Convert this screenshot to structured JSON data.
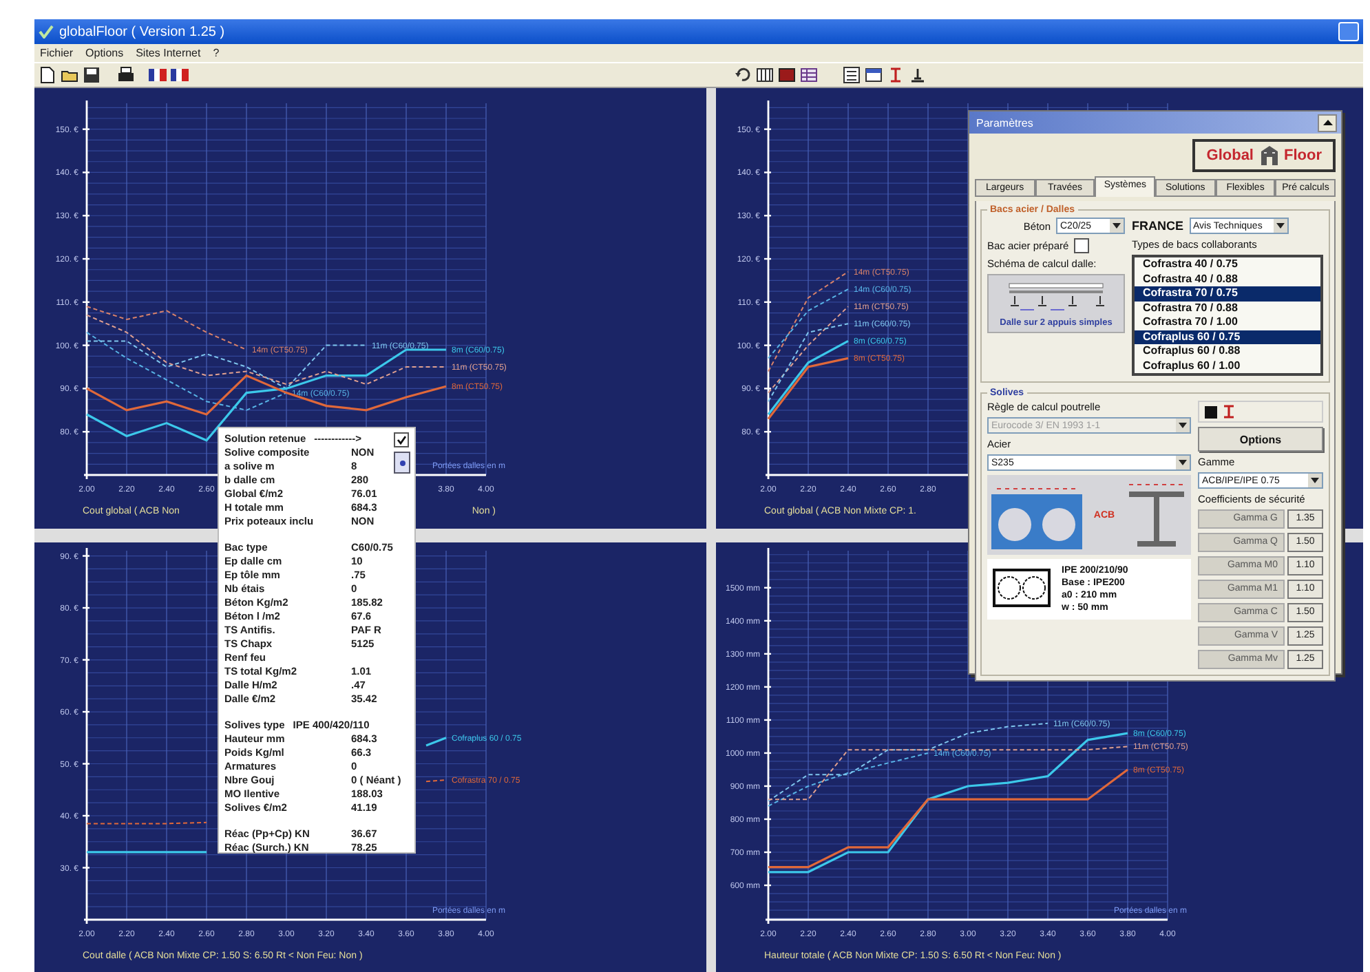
{
  "window": {
    "title": "globalFloor ( Version 1.25 )"
  },
  "menu": [
    "Fichier",
    "Options",
    "Sites Internet",
    "?"
  ],
  "charts": [
    {
      "footer": [
        "Cout global ( ACB Non",
        "Non )"
      ],
      "chart_data": {
        "type": "line",
        "grid": true,
        "x": [
          2,
          2.2,
          2.4,
          2.6,
          2.8,
          3,
          3.2,
          3.4,
          3.6,
          3.8
        ],
        "xlim": [
          2,
          4
        ],
        "ylim": [
          70,
          156
        ],
        "xlabel": "Portées dalles en m",
        "xticks": [
          {
            "value": 2,
            "label": "2.00"
          },
          {
            "value": 2.2,
            "label": "2.20"
          },
          {
            "value": 2.4,
            "label": "2.40"
          },
          {
            "value": 2.6,
            "label": "2.60"
          },
          {
            "value": 3.8,
            "label": "3.80"
          },
          {
            "value": 4,
            "label": "4.00"
          }
        ],
        "yticks": [
          {
            "value": 150,
            "label": "150. €"
          },
          {
            "value": 140,
            "label": "140. €"
          },
          {
            "value": 130,
            "label": "130. €"
          },
          {
            "value": 120,
            "label": "120. €"
          },
          {
            "value": 110,
            "label": "110. €"
          },
          {
            "value": 100,
            "label": "100. €"
          },
          {
            "value": 90,
            "label": "90. €"
          },
          {
            "value": 80,
            "label": "80. €"
          }
        ],
        "series": [
          {
            "name": "14m (CT50.75)",
            "color": "#d9826a",
            "line_style": "dashed",
            "values": [
              109,
              106,
              108,
              103,
              99,
              null,
              null,
              null,
              null,
              null
            ]
          },
          {
            "name": "14m (C60/0.75)",
            "color": "#58b4e6",
            "line_style": "dashed",
            "values": [
              103,
              97,
              92,
              87,
              85,
              89,
              null,
              null,
              null,
              null
            ]
          },
          {
            "name": "11m (C60/0.75)",
            "color": "#7fc6ee",
            "line_style": "dashed",
            "values": [
              101,
              101,
              95,
              98,
              95,
              90,
              100,
              100,
              null,
              null
            ]
          },
          {
            "name": "8m (C60/0.75)",
            "color": "#3cc8ea",
            "line_style": "solid",
            "values": [
              84,
              79,
              82,
              78,
              89,
              90,
              93,
              93,
              99,
              99
            ]
          },
          {
            "name": "11m (CT50.75)",
            "color": "#e0a090",
            "line_style": "dashed",
            "values": [
              107,
              103,
              96,
              93,
              94,
              91,
              94,
              91,
              95,
              95
            ]
          },
          {
            "name": "8m (CT50.75)",
            "color": "#e0683a",
            "line_style": "solid",
            "values": [
              90,
              85,
              87,
              84,
              93,
              89,
              86,
              85,
              88,
              90.5
            ]
          }
        ]
      }
    },
    {
      "footer": [
        "Cout global ( ACB Non Mixte CP: 1."
      ],
      "chart_data": {
        "type": "line",
        "grid": true,
        "x": [
          2,
          2.2,
          2.4
        ],
        "xlim": [
          2,
          4
        ],
        "ylim": [
          70,
          156
        ],
        "xticks": [
          {
            "value": 2,
            "label": "2.00"
          },
          {
            "value": 2.2,
            "label": "2.20"
          },
          {
            "value": 2.4,
            "label": "2.40"
          },
          {
            "value": 2.6,
            "label": "2.60"
          },
          {
            "value": 2.8,
            "label": "2.80"
          }
        ],
        "yticks": [
          {
            "value": 150,
            "label": "150. €"
          },
          {
            "value": 140,
            "label": "140. €"
          },
          {
            "value": 130,
            "label": "130. €"
          },
          {
            "value": 120,
            "label": "120. €"
          },
          {
            "value": 110,
            "label": "110. €"
          },
          {
            "value": 100,
            "label": "100. €"
          },
          {
            "value": 90,
            "label": "90. €"
          },
          {
            "value": 80,
            "label": "80. €"
          }
        ],
        "series": [
          {
            "name": "14m (CT50.75)",
            "color": "#d9826a",
            "line_style": "dashed",
            "values": [
              94,
              111,
              117
            ]
          },
          {
            "name": "14m (C60/0.75)",
            "color": "#58b4e6",
            "line_style": "dashed",
            "values": [
              97,
              108,
              113
            ]
          },
          {
            "name": "11m (CT50.75)",
            "color": "#e0a090",
            "line_style": "dashed",
            "values": [
              89,
              100,
              109
            ]
          },
          {
            "name": "11m (C60/0.75)",
            "color": "#7fc6ee",
            "line_style": "dashed",
            "values": [
              87,
              103,
              105
            ]
          },
          {
            "name": "8m (C60/0.75)",
            "color": "#3cc8ea",
            "line_style": "solid",
            "values": [
              84,
              96,
              101
            ]
          },
          {
            "name": "8m (CT50.75)",
            "color": "#e0683a",
            "line_style": "solid",
            "values": [
              83,
              95,
              97
            ]
          }
        ]
      }
    },
    {
      "footer": [
        "Cout dalle ( ACB Non Mixte CP: 1.50 S: 6.50 Rt < Non Feu: Non )"
      ],
      "chart_data": {
        "type": "line",
        "grid": true,
        "x": [
          2,
          2.2,
          2.4,
          2.6,
          3.7,
          3.8
        ],
        "xlim": [
          2,
          4
        ],
        "ylim": [
          20,
          91
        ],
        "xlabel": "Portées dalles en m",
        "xticks": [
          {
            "value": 2,
            "label": "2.00"
          },
          {
            "value": 2.2,
            "label": "2.20"
          },
          {
            "value": 2.4,
            "label": "2.40"
          },
          {
            "value": 2.6,
            "label": "2.60"
          },
          {
            "value": 2.8,
            "label": "2.80"
          },
          {
            "value": 3,
            "label": "3.00"
          },
          {
            "value": 3.2,
            "label": "3.20"
          },
          {
            "value": 3.4,
            "label": "3.40"
          },
          {
            "value": 3.6,
            "label": "3.60"
          },
          {
            "value": 3.8,
            "label": "3.80"
          },
          {
            "value": 4,
            "label": "4.00"
          }
        ],
        "yticks": [
          {
            "value": 90,
            "label": "90. €"
          },
          {
            "value": 80,
            "label": "80. €"
          },
          {
            "value": 70,
            "label": "70. €"
          },
          {
            "value": 60,
            "label": "60. €"
          },
          {
            "value": 50,
            "label": "50. €"
          },
          {
            "value": 40,
            "label": "40. €"
          },
          {
            "value": 30,
            "label": "30. €"
          }
        ],
        "series": [
          {
            "name": "Cofraplus 60 / 0.75",
            "color": "#3cc8ea",
            "line_style": "solid",
            "values": [
              33,
              33,
              33,
              33,
              53.5,
              55
            ]
          },
          {
            "name": "Cofrastra 70 / 0.75",
            "color": "#e0683a",
            "line_style": "dashed",
            "values": [
              38.5,
              38.5,
              38.5,
              38.7,
              46.6,
              46.9
            ]
          }
        ]
      }
    },
    {
      "footer": [
        "Hauteur totale ( ACB Non Mixte CP: 1.50 S: 6.50 Rt < Non Feu: Non )"
      ],
      "chart_data": {
        "type": "line",
        "grid": true,
        "x": [
          2,
          2.2,
          2.4,
          2.6,
          2.8,
          3,
          3.2,
          3.4,
          3.6,
          3.8
        ],
        "xlim": [
          2,
          4
        ],
        "ylim": [
          496,
          1612
        ],
        "xlabel": "Portées dalles en m",
        "xticks": [
          {
            "value": 2,
            "label": "2.00"
          },
          {
            "value": 2.2,
            "label": "2.20"
          },
          {
            "value": 2.4,
            "label": "2.40"
          },
          {
            "value": 2.6,
            "label": "2.60"
          },
          {
            "value": 2.8,
            "label": "2.80"
          },
          {
            "value": 3,
            "label": "3.00"
          },
          {
            "value": 3.2,
            "label": "3.20"
          },
          {
            "value": 3.4,
            "label": "3.40"
          },
          {
            "value": 3.6,
            "label": "3.60"
          },
          {
            "value": 3.8,
            "label": "3.80"
          },
          {
            "value": 4,
            "label": "4.00"
          }
        ],
        "yticks": [
          {
            "value": 1500,
            "label": "1500 mm"
          },
          {
            "value": 1400,
            "label": "1400 mm"
          },
          {
            "value": 1300,
            "label": "1300 mm"
          },
          {
            "value": 1200,
            "label": "1200 mm"
          },
          {
            "value": 1100,
            "label": "1100 mm"
          },
          {
            "value": 1000,
            "label": "1000 mm"
          },
          {
            "value": 900,
            "label": "900 mm"
          },
          {
            "value": 800,
            "label": "800 mm"
          },
          {
            "value": 700,
            "label": "700 mm"
          },
          {
            "value": 600,
            "label": "600 mm"
          }
        ],
        "series": [
          {
            "name": "14m (C60/0.75)",
            "color": "#58b4e6",
            "line_style": "dashed",
            "values": [
              840,
              900,
              940,
              970,
              1000,
              null,
              null,
              null,
              null,
              null
            ]
          },
          {
            "name": "11m (C60/0.75)",
            "color": "#7fc6ee",
            "line_style": "dashed",
            "values": [
              855,
              935,
              935,
              1010,
              1010,
              1060,
              1080,
              1090,
              null,
              null
            ]
          },
          {
            "name": "8m (C60/0.75)",
            "color": "#3cc8ea",
            "line_style": "solid",
            "values": [
              640,
              640,
              700,
              700,
              860,
              900,
              910,
              930,
              1040,
              1060
            ]
          },
          {
            "name": "11m (CT50.75)",
            "color": "#e0a090",
            "line_style": "dashed",
            "values": [
              860,
              860,
              1010,
              1010,
              1010,
              1010,
              1010,
              1010,
              1010,
              1020
            ]
          },
          {
            "name": "8m (CT50.75)",
            "color": "#e0683a",
            "line_style": "solid",
            "values": [
              655,
              655,
              715,
              715,
              860,
              860,
              860,
              860,
              860,
              950
            ]
          }
        ]
      }
    }
  ],
  "solution_popup": {
    "checked": true,
    "sections": [
      [
        {
          "kind": "inline",
          "label": "Solution retenue",
          "value": "------------>"
        },
        {
          "kind": "pair",
          "label": "Solive composite",
          "value": "NON"
        },
        {
          "kind": "pair",
          "label": "a solive m",
          "value": "8"
        },
        {
          "kind": "pair",
          "label": "b dalle cm",
          "value": "280"
        },
        {
          "kind": "pair",
          "label": "Global €/m2",
          "value": "76.01"
        },
        {
          "kind": "pair",
          "label": "H totale mm",
          "value": "684.3"
        },
        {
          "kind": "pair",
          "label": "Prix poteaux inclu",
          "value": "NON"
        }
      ],
      [
        {
          "kind": "pair",
          "label": "Bac type",
          "value": "C60/0.75"
        },
        {
          "kind": "pair",
          "label": "Ep dalle cm",
          "value": "10"
        },
        {
          "kind": "pair",
          "label": "Ep tôle mm",
          "value": ".75"
        },
        {
          "kind": "pair",
          "label": "Nb étais",
          "value": "0"
        },
        {
          "kind": "pair",
          "label": "Béton Kg/m2",
          "value": "185.82"
        },
        {
          "kind": "pair",
          "label": "Béton l /m2",
          "value": "67.6"
        },
        {
          "kind": "pair",
          "label": "TS Antifis.",
          "value": "PAF R"
        },
        {
          "kind": "pair",
          "label": "TS Chapx",
          "value": "5125"
        },
        {
          "kind": "pair",
          "label": "Renf feu"
        },
        {
          "kind": "pair",
          "label": "TS total Kg/m2",
          "value": "1.01"
        },
        {
          "kind": "pair",
          "label": "Dalle H/m2",
          "value": ".47"
        },
        {
          "kind": "pair",
          "label": "Dalle €/m2",
          "value": "35.42"
        }
      ],
      [
        {
          "kind": "inline",
          "label": "Solives type",
          "value": "IPE 400/420/110"
        },
        {
          "kind": "pair",
          "label": "Hauteur mm",
          "value": "684.3"
        },
        {
          "kind": "pair",
          "label": "Poids Kg/ml",
          "value": "66.3"
        },
        {
          "kind": "pair",
          "label": "Armatures",
          "value": "0"
        },
        {
          "kind": "pair",
          "label": "Nbre Gouj",
          "value": "0 ( Néant )"
        },
        {
          "kind": "pair",
          "label": "MO Ilentive",
          "value": "188.03"
        },
        {
          "kind": "pair",
          "label": "Solives €/m2",
          "value": "41.19"
        }
      ],
      [
        {
          "kind": "pair",
          "label": "Réac (Pp+Cp) KN",
          "value": "36.67"
        },
        {
          "kind": "pair",
          "label": "Réac (Surch.) KN",
          "value": "78.25"
        }
      ]
    ]
  },
  "parameters_panel": {
    "title": "Paramètres",
    "logo": {
      "left": "Global",
      "right": "Floor"
    },
    "tabs": [
      {
        "label": "Largeurs",
        "selected": false
      },
      {
        "label": "Travées",
        "selected": false
      },
      {
        "label": "Systèmes",
        "selected": true
      },
      {
        "label": "Solutions",
        "selected": false
      },
      {
        "label": "Flexibles",
        "selected": false
      },
      {
        "label": "Pré calculs",
        "selected": false
      }
    ],
    "slab_group": {
      "legend": "Bacs acier / Dalles",
      "concrete_label": "Béton",
      "concrete_value": "C20/25",
      "prepared_label": "Bac acier préparé",
      "prepared_checked": false,
      "scheme_label": "Schéma de calcul dalle:",
      "scheme_caption": "Dalle sur 2 appuis simples",
      "country": "FRANCE",
      "standard_value": "Avis Techniques",
      "types_label": "Types de bacs collaborants",
      "types": [
        {
          "label": "Cofrastra 40 / 0.75",
          "selected": false
        },
        {
          "label": "Cofrastra 40 / 0.88",
          "selected": false
        },
        {
          "label": "Cofrastra 70 / 0.75",
          "selected": true
        },
        {
          "label": "Cofrastra 70 / 0.88",
          "selected": false
        },
        {
          "label": "Cofrastra 70 / 1.00",
          "selected": false
        },
        {
          "label": "Cofraplus 60 / 0.75",
          "selected": true
        },
        {
          "label": "Cofraplus 60 / 0.88",
          "selected": false
        },
        {
          "label": "Cofraplus 60 / 1.00",
          "selected": false
        }
      ]
    },
    "beam_group": {
      "legend": "Solives",
      "rule_label": "Règle de calcul poutrelle",
      "rule_value": "Eurocode 3/ EN 1993 1-1",
      "rule_disabled": true,
      "options_button": "Options",
      "steel_label": "Acier",
      "steel_value": "S235",
      "section_tag": "ACB",
      "card_lines": [
        "IPE 200/210/90",
        "Base : IPE200",
        "a0 : 210 mm",
        "w : 50 mm"
      ],
      "range_label": "Gamme",
      "range_value": "ACB/IPE/IPE 0.75",
      "coef_label": "Coefficients de sécurité",
      "coefficients": [
        {
          "label": "Gamma G",
          "value": "1.35"
        },
        {
          "label": "Gamma Q",
          "value": "1.50"
        },
        {
          "label": "Gamma M0",
          "value": "1.10"
        },
        {
          "label": "Gamma M1",
          "value": "1.10"
        },
        {
          "label": "Gamma C",
          "value": "1.50"
        },
        {
          "label": "Gamma V",
          "value": "1.25"
        },
        {
          "label": "Gamma Mv",
          "value": "1.25"
        }
      ]
    }
  }
}
